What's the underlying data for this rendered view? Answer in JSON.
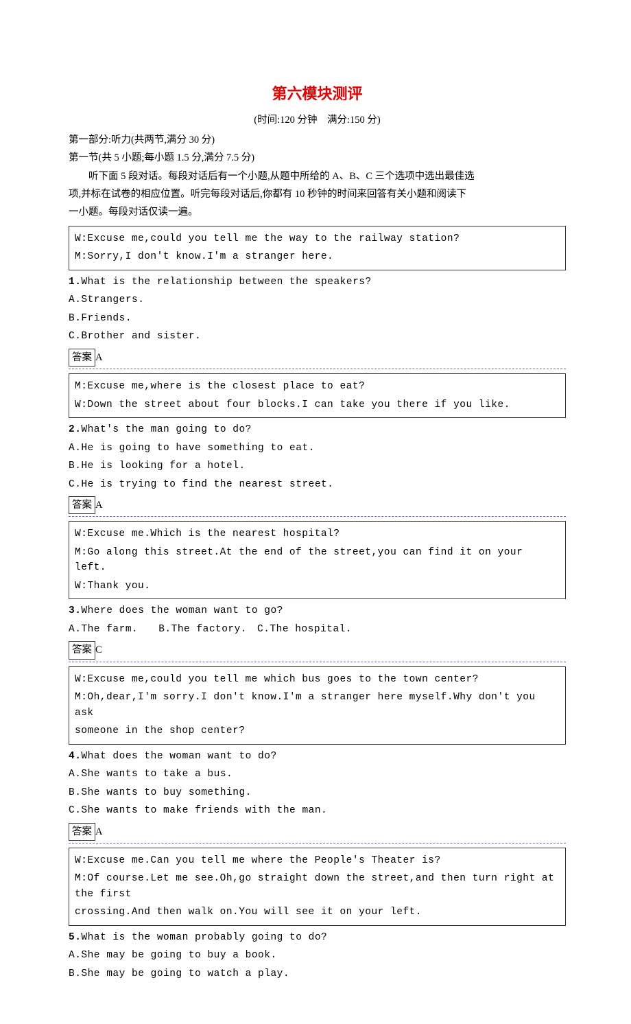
{
  "title": "第六模块测评",
  "subline": "(时间:120 分钟　满分:150 分)",
  "part1": "第一部分:听力(共两节,满分 30 分)",
  "section1": "第一节(共 5 小题;每小题 1.5 分,满分 7.5 分)",
  "intro1": "听下面 5 段对话。每段对话后有一个小题,从题中所给的 A、B、C 三个选项中选出最佳选",
  "intro2": "项,并标在试卷的相应位置。听完每段对话后,你都有 10 秒钟的时间来回答有关小题和阅读下",
  "intro3": "一小题。每段对话仅读一遍。",
  "d1": {
    "l1": "W:Excuse me,could you tell me the way to the railway station?",
    "l2": "M:Sorry,I don't know.I'm a stranger here."
  },
  "q1": {
    "num": "1.",
    "text": "What is the relationship between the speakers?",
    "a": "A.Strangers.",
    "b": "B.Friends.",
    "c": "C.Brother and sister.",
    "ans_label": "答案",
    "ans": "A"
  },
  "d2": {
    "l1": "M:Excuse me,where is the closest place to eat?",
    "l2": "W:Down the street about four blocks.I can take you there if you like."
  },
  "q2": {
    "num": "2.",
    "text": "What's the man going to do?",
    "a": "A.He is going to have something to eat.",
    "b": "B.He is looking for a hotel.",
    "c": "C.He is trying to find the nearest street.",
    "ans_label": "答案",
    "ans": "A"
  },
  "d3": {
    "l1": "W:Excuse me.Which is the nearest hospital?",
    "l2": "M:Go along this street.At the end of the street,you can find it on your left.",
    "l3": "W:Thank you."
  },
  "q3": {
    "num": "3.",
    "text": "Where does the woman want to go?",
    "a": "A.The farm.",
    "b": "B.The factory.",
    "c": "C.The hospital.",
    "ans_label": "答案",
    "ans": "C"
  },
  "d4": {
    "l1": "W:Excuse me,could you tell me which bus goes to the town center?",
    "l2": "M:Oh,dear,I'm sorry.I don't know.I'm a stranger here myself.Why don't you ask",
    "l3": "someone in the shop center?"
  },
  "q4": {
    "num": "4.",
    "text": "What does the woman want to do?",
    "a": "A.She wants to take a bus.",
    "b": "B.She wants to buy something.",
    "c": "C.She wants to make friends with the man.",
    "ans_label": "答案",
    "ans": "A"
  },
  "d5": {
    "l1": "W:Excuse me.Can you tell me where the People's Theater is?",
    "l2": "M:Of course.Let me see.Oh,go straight down the street,and then turn right at the first",
    "l3": "crossing.And then walk on.You will see it on your left."
  },
  "q5": {
    "num": "5.",
    "text": "What is the woman probably going to do?",
    "a": "A.She may be going to buy a book.",
    "b": "B.She may be going to watch a play."
  }
}
